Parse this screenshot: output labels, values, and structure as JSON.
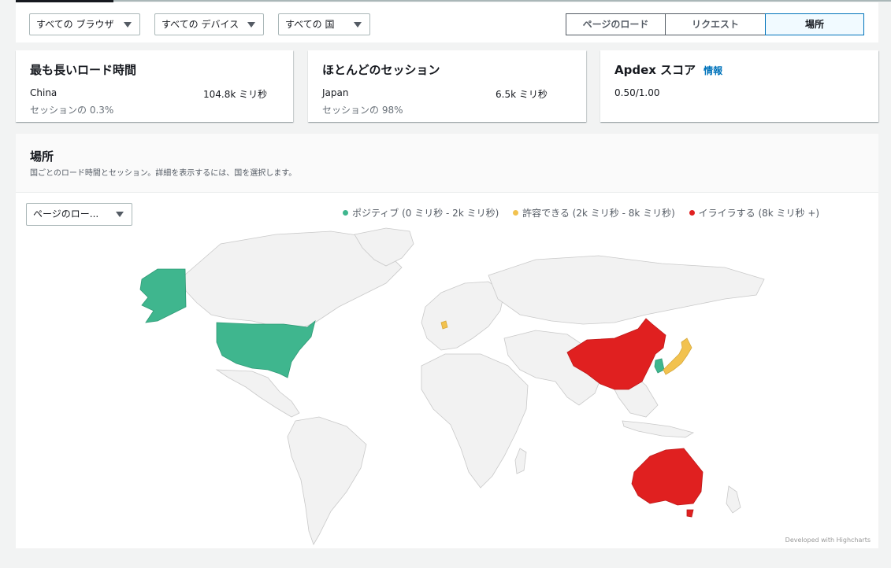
{
  "filters": {
    "browser": "すべての ブラウザ",
    "device": "すべての デバイス",
    "country": "すべての 国"
  },
  "view_tabs": [
    {
      "label": "ページのロード",
      "selected": false
    },
    {
      "label": "リクエスト",
      "selected": false
    },
    {
      "label": "場所",
      "selected": true
    }
  ],
  "cards": {
    "longest": {
      "title": "最も長いロード時間",
      "country": "China",
      "value": "104.8k ミリ秒",
      "share": "セッションの 0.3%"
    },
    "most": {
      "title": "ほとんどのセッション",
      "country": "Japan",
      "value": "6.5k ミリ秒",
      "share": "セッションの 98%"
    },
    "apdex": {
      "title": "Apdex スコア",
      "info": "情報",
      "value": "0.50/1.00"
    }
  },
  "location": {
    "title": "場所",
    "description": "国ごとのロード時間とセッション。詳細を表示するには、国を選択します。",
    "metric_select": "ページのロー...",
    "legend": [
      {
        "label": "ポジティブ (0 ミリ秒 - 2k ミリ秒)",
        "color": "#3fb68e"
      },
      {
        "label": "許容できる (2k ミリ秒 - 8k ミリ秒)",
        "color": "#f2c24f"
      },
      {
        "label": "イライラする (8k ミリ秒 +)",
        "color": "#e02020"
      }
    ],
    "credit": "Developed with Highcharts"
  },
  "country_colors": {
    "positive": "#3fb68e",
    "acceptable": "#f2c24f",
    "frustrating": "#e02020",
    "none": "#f2f2f2"
  }
}
